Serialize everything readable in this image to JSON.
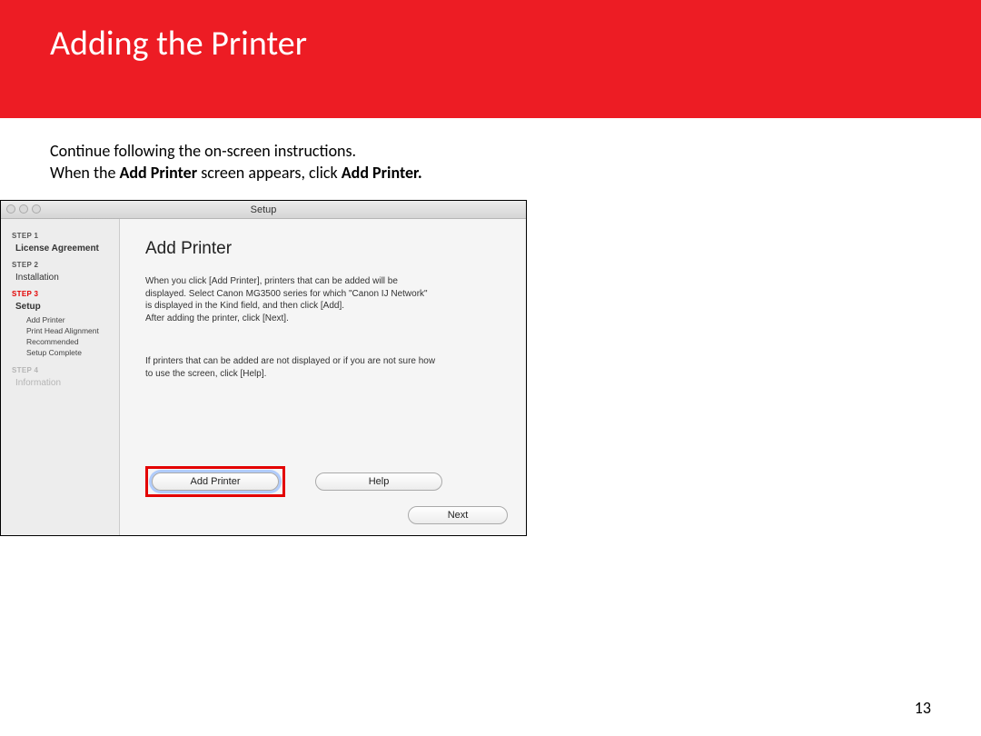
{
  "slide": {
    "title": "Adding  the Printer",
    "intro_line1": "Continue following the on-screen instructions.",
    "intro_line2_pre": "When the ",
    "intro_line2_b1": "Add Printer",
    "intro_line2_mid": " screen appears, click ",
    "intro_line2_b2": "Add Printer.",
    "page_number": "13"
  },
  "window": {
    "title": "Setup",
    "sidebar": {
      "step1": "STEP 1",
      "step1_item": "License Agreement",
      "step2": "STEP 2",
      "step2_item": "Installation",
      "step3": "STEP 3",
      "step3_item": "Setup",
      "sub1": "Add Printer",
      "sub2": "Print Head Alignment Recommended",
      "sub3": "Setup Complete",
      "step4": "STEP 4",
      "step4_item": "Information"
    },
    "panel": {
      "heading": "Add Printer",
      "para1": "When you click [Add Printer], printers that can be added will be displayed. Select Canon MG3500 series for which \"Canon IJ Network\" is displayed in the Kind field, and then click [Add].\nAfter adding the printer, click [Next].",
      "para2": "If printers that can be added are not displayed or if you are not sure how to use the screen, click [Help].",
      "add_printer_btn": "Add Printer",
      "help_btn": "Help",
      "next_btn": "Next"
    }
  }
}
